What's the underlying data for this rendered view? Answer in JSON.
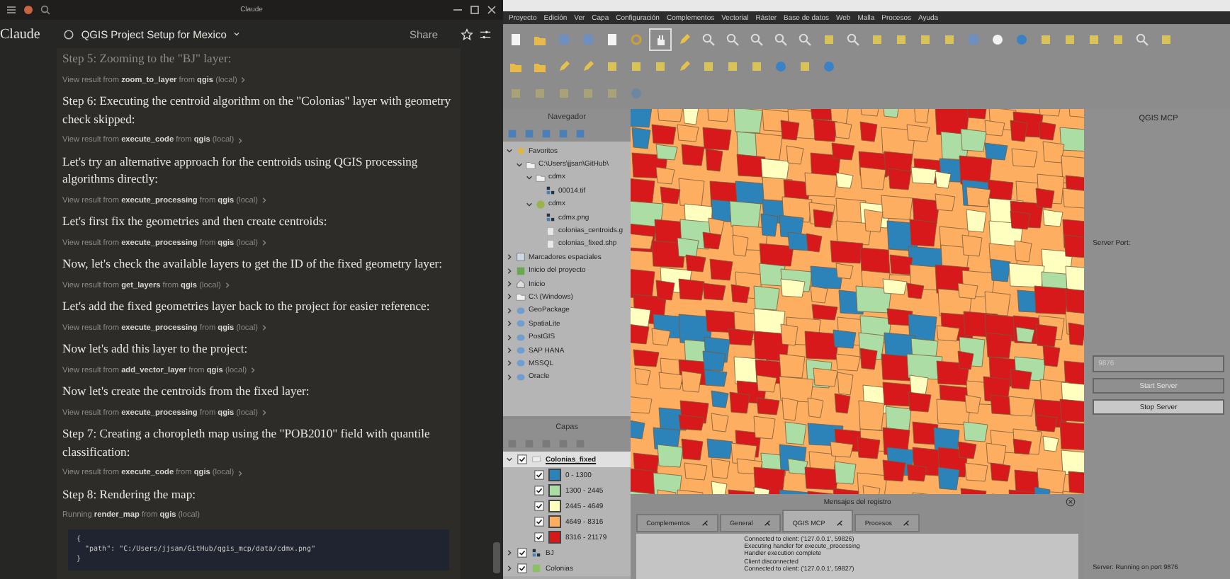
{
  "claude": {
    "window_title": "Claude",
    "app_name": "Claude",
    "conversation_title": "QGIS Project Setup for Mexico",
    "share": "Share",
    "messages": [
      {
        "kind": "text",
        "text": "Step 5: Zooming to the \"BJ\" layer:"
      },
      {
        "kind": "tool",
        "text": "View result from **zoom_to_layer** from **qgis** (local)"
      },
      {
        "kind": "text",
        "text": "Step 6: Executing the centroid algorithm on the \"Colonias\" layer with geometry check skipped:"
      },
      {
        "kind": "tool",
        "text": "View result from **execute_code** from **qgis** (local)"
      },
      {
        "kind": "text",
        "text": "Let's try an alternative approach for the centroids using QGIS processing algorithms directly:"
      },
      {
        "kind": "tool",
        "text": "View result from **execute_processing** from **qgis** (local)"
      },
      {
        "kind": "text",
        "text": "Let's first fix the geometries and then create centroids:"
      },
      {
        "kind": "tool",
        "text": "View result from **execute_processing** from **qgis** (local)"
      },
      {
        "kind": "text",
        "text": "Now, let's check the available layers to get the ID of the fixed geometry layer:"
      },
      {
        "kind": "tool",
        "text": "View result from **get_layers** from **qgis** (local)"
      },
      {
        "kind": "text",
        "text": "Let's add the fixed geometries layer back to the project for easier reference:"
      },
      {
        "kind": "tool",
        "text": "View result from **execute_processing** from **qgis** (local)"
      },
      {
        "kind": "text",
        "text": "Now let's add this layer to the project:"
      },
      {
        "kind": "tool",
        "text": "View result from **add_vector_layer** from **qgis** (local)"
      },
      {
        "kind": "text",
        "text": "Now let's create the centroids from the fixed layer:"
      },
      {
        "kind": "tool",
        "text": "View result from **execute_processing** from **qgis** (local)"
      },
      {
        "kind": "text",
        "text": "Step 7: Creating a choropleth map using the \"POB2010\" field with quantile classification:"
      },
      {
        "kind": "tool",
        "text": "View result from **execute_code** from **qgis** (local)"
      },
      {
        "kind": "text",
        "text": "Step 8: Rendering the map:"
      },
      {
        "kind": "running",
        "text": "Running **render_map** from **qgis** (local)"
      },
      {
        "kind": "code",
        "lines": [
          "{",
          "  \"path\": \"C:/Users/jjsan/GitHub/qgis_mcp/data/cdmx.png\"",
          "}"
        ]
      }
    ]
  },
  "qgis": {
    "menu": [
      "Proyecto",
      "Edición",
      "Ver",
      "Capa",
      "Configuración",
      "Complementos",
      "Vectorial",
      "Ráster",
      "Base de datos",
      "Web",
      "Malla",
      "Procesos",
      "Ayuda"
    ],
    "browser": {
      "title": "Navegador",
      "items": [
        {
          "label": "Favoritos",
          "kind": "favorites",
          "expanded": true,
          "children": [
            {
              "label": "C:\\Users\\jjsan\\GitHub\\",
              "kind": "folder",
              "expanded": true,
              "children": [
                {
                  "label": "cdmx",
                  "kind": "folder",
                  "expanded": true,
                  "children": [
                    {
                      "label": "00014.tif",
                      "kind": "raster"
                    }
                  ]
                },
                {
                  "label": "cdmx",
                  "kind": "geopackage",
                  "expanded": true,
                  "children": [
                    {
                      "label": "cdmx.png",
                      "kind": "raster"
                    },
                    {
                      "label": "colonias_centroids.g",
                      "kind": "file"
                    },
                    {
                      "label": "colonias_fixed.shp",
                      "kind": "file"
                    }
                  ]
                }
              ]
            }
          ]
        },
        {
          "label": "Marcadores espaciales",
          "kind": "bookmarks",
          "expanded": false
        },
        {
          "label": "Inicio del proyecto",
          "kind": "project",
          "expanded": false
        },
        {
          "label": "Inicio",
          "kind": "home",
          "expanded": false
        },
        {
          "label": "C:\\ (Windows)",
          "kind": "folder",
          "expanded": false
        },
        {
          "label": "GeoPackage",
          "kind": "database",
          "expanded": false
        },
        {
          "label": "SpatiaLite",
          "kind": "database",
          "expanded": false
        },
        {
          "label": "PostGIS",
          "kind": "database",
          "expanded": false
        },
        {
          "label": "SAP HANA",
          "kind": "database",
          "expanded": false
        },
        {
          "label": "MSSQL",
          "kind": "database",
          "expanded": false
        },
        {
          "label": "Oracle",
          "kind": "database",
          "expanded": false
        }
      ]
    },
    "layers": {
      "title": "Capas",
      "items": [
        {
          "label": "Colonias_fixed",
          "kind": "vector",
          "checked": true,
          "expanded": true,
          "selected": true,
          "classes": [
            {
              "label": "0 - 1300",
              "checked": true,
              "color": "#2b83ba"
            },
            {
              "label": "1300 - 2445",
              "checked": true,
              "color": "#abdda4"
            },
            {
              "label": "2445 - 4649",
              "checked": true,
              "color": "#ffffbf"
            },
            {
              "label": "4649 - 8316",
              "checked": true,
              "color": "#fdae61"
            },
            {
              "label": "8316 - 21179",
              "checked": true,
              "color": "#d7191c"
            }
          ]
        },
        {
          "label": "BJ",
          "kind": "raster",
          "checked": true,
          "expanded": false,
          "selected": false
        },
        {
          "label": "Colonias",
          "kind": "polygon",
          "checked": true,
          "expanded": false,
          "selected": false
        }
      ]
    },
    "log": {
      "title": "Mensajes del registro",
      "tabs": [
        {
          "label": "Complementos",
          "selected": false
        },
        {
          "label": "General",
          "selected": false
        },
        {
          "label": "QGIS MCP",
          "selected": true
        },
        {
          "label": "Procesos",
          "selected": false
        }
      ],
      "lines": [
        "Connected to client: ('127.0.0.1', 59826)",
        "Executing handler for execute_processing",
        "Handler execution complete",
        "Client disconnected",
        "Connected to client: ('127.0.0.1', 59827)"
      ]
    },
    "mcp": {
      "title": "QGIS MCP",
      "port_label": "Server Port:",
      "port": "9876",
      "start": {
        "label": "Start Server",
        "disabled": true
      },
      "stop": {
        "label": "Stop Server",
        "disabled": false
      },
      "status": "Server: Running on port 9876"
    }
  }
}
